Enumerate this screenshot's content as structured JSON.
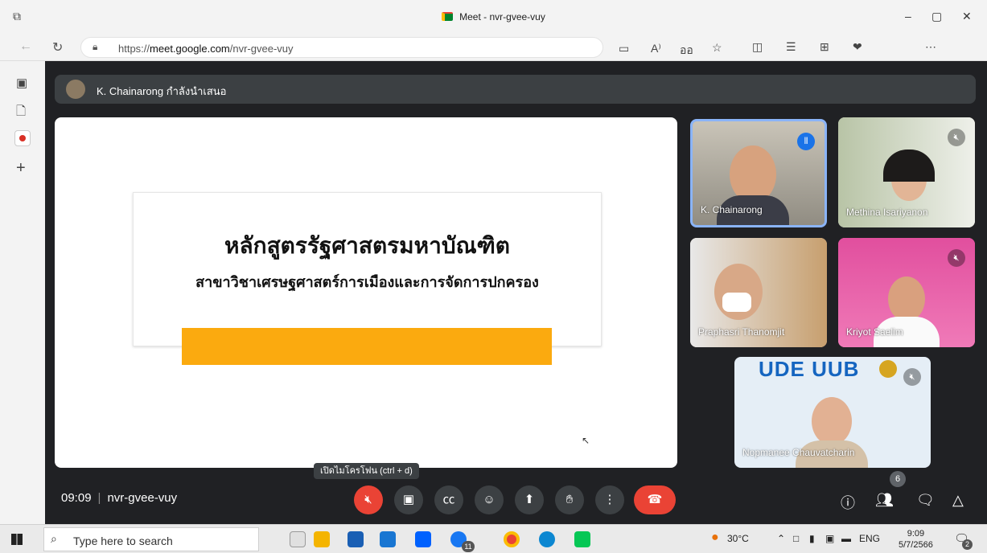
{
  "browser": {
    "window_title": "Meet - nvr-gvee-vuy",
    "url_prefix": "https://",
    "url_domain": "meet.google.com",
    "url_path": "/nvr-gvee-vuy",
    "read_aloud": "A⁾",
    "translate": "ออ"
  },
  "meet": {
    "presenter_text": "K. Chainarong กำลังนำเสนอ",
    "slide_title": "หลักสูตรรัฐศาสตรมหาบัณฑิต",
    "slide_subtitle": "สาขาวิชาเศรษฐศาสตร์การเมืองและการจัดการปกครอง",
    "participants": [
      {
        "name": "K. Chainarong",
        "speaking": true
      },
      {
        "name": "Methina Isariyanon",
        "muted": true
      },
      {
        "name": "Praphasri Thanomjit"
      },
      {
        "name": "Kriyot Saelim",
        "muted": true
      },
      {
        "name": "Nopmanee Chauvatcharin",
        "muted": true
      }
    ],
    "bu_logo_text": "UDE UUB",
    "time": "09:09",
    "meeting_code": "nvr-gvee-vuy",
    "mic_tooltip": "เปิดไมโครโฟน (ctrl + d)",
    "people_count": "6"
  },
  "taskbar": {
    "search_placeholder": "Type here to search",
    "facebook_badge": "11",
    "temperature": "30°C",
    "language": "ENG",
    "clock_time": "9:09",
    "clock_date": "5/7/2566",
    "notification_count": "2"
  }
}
